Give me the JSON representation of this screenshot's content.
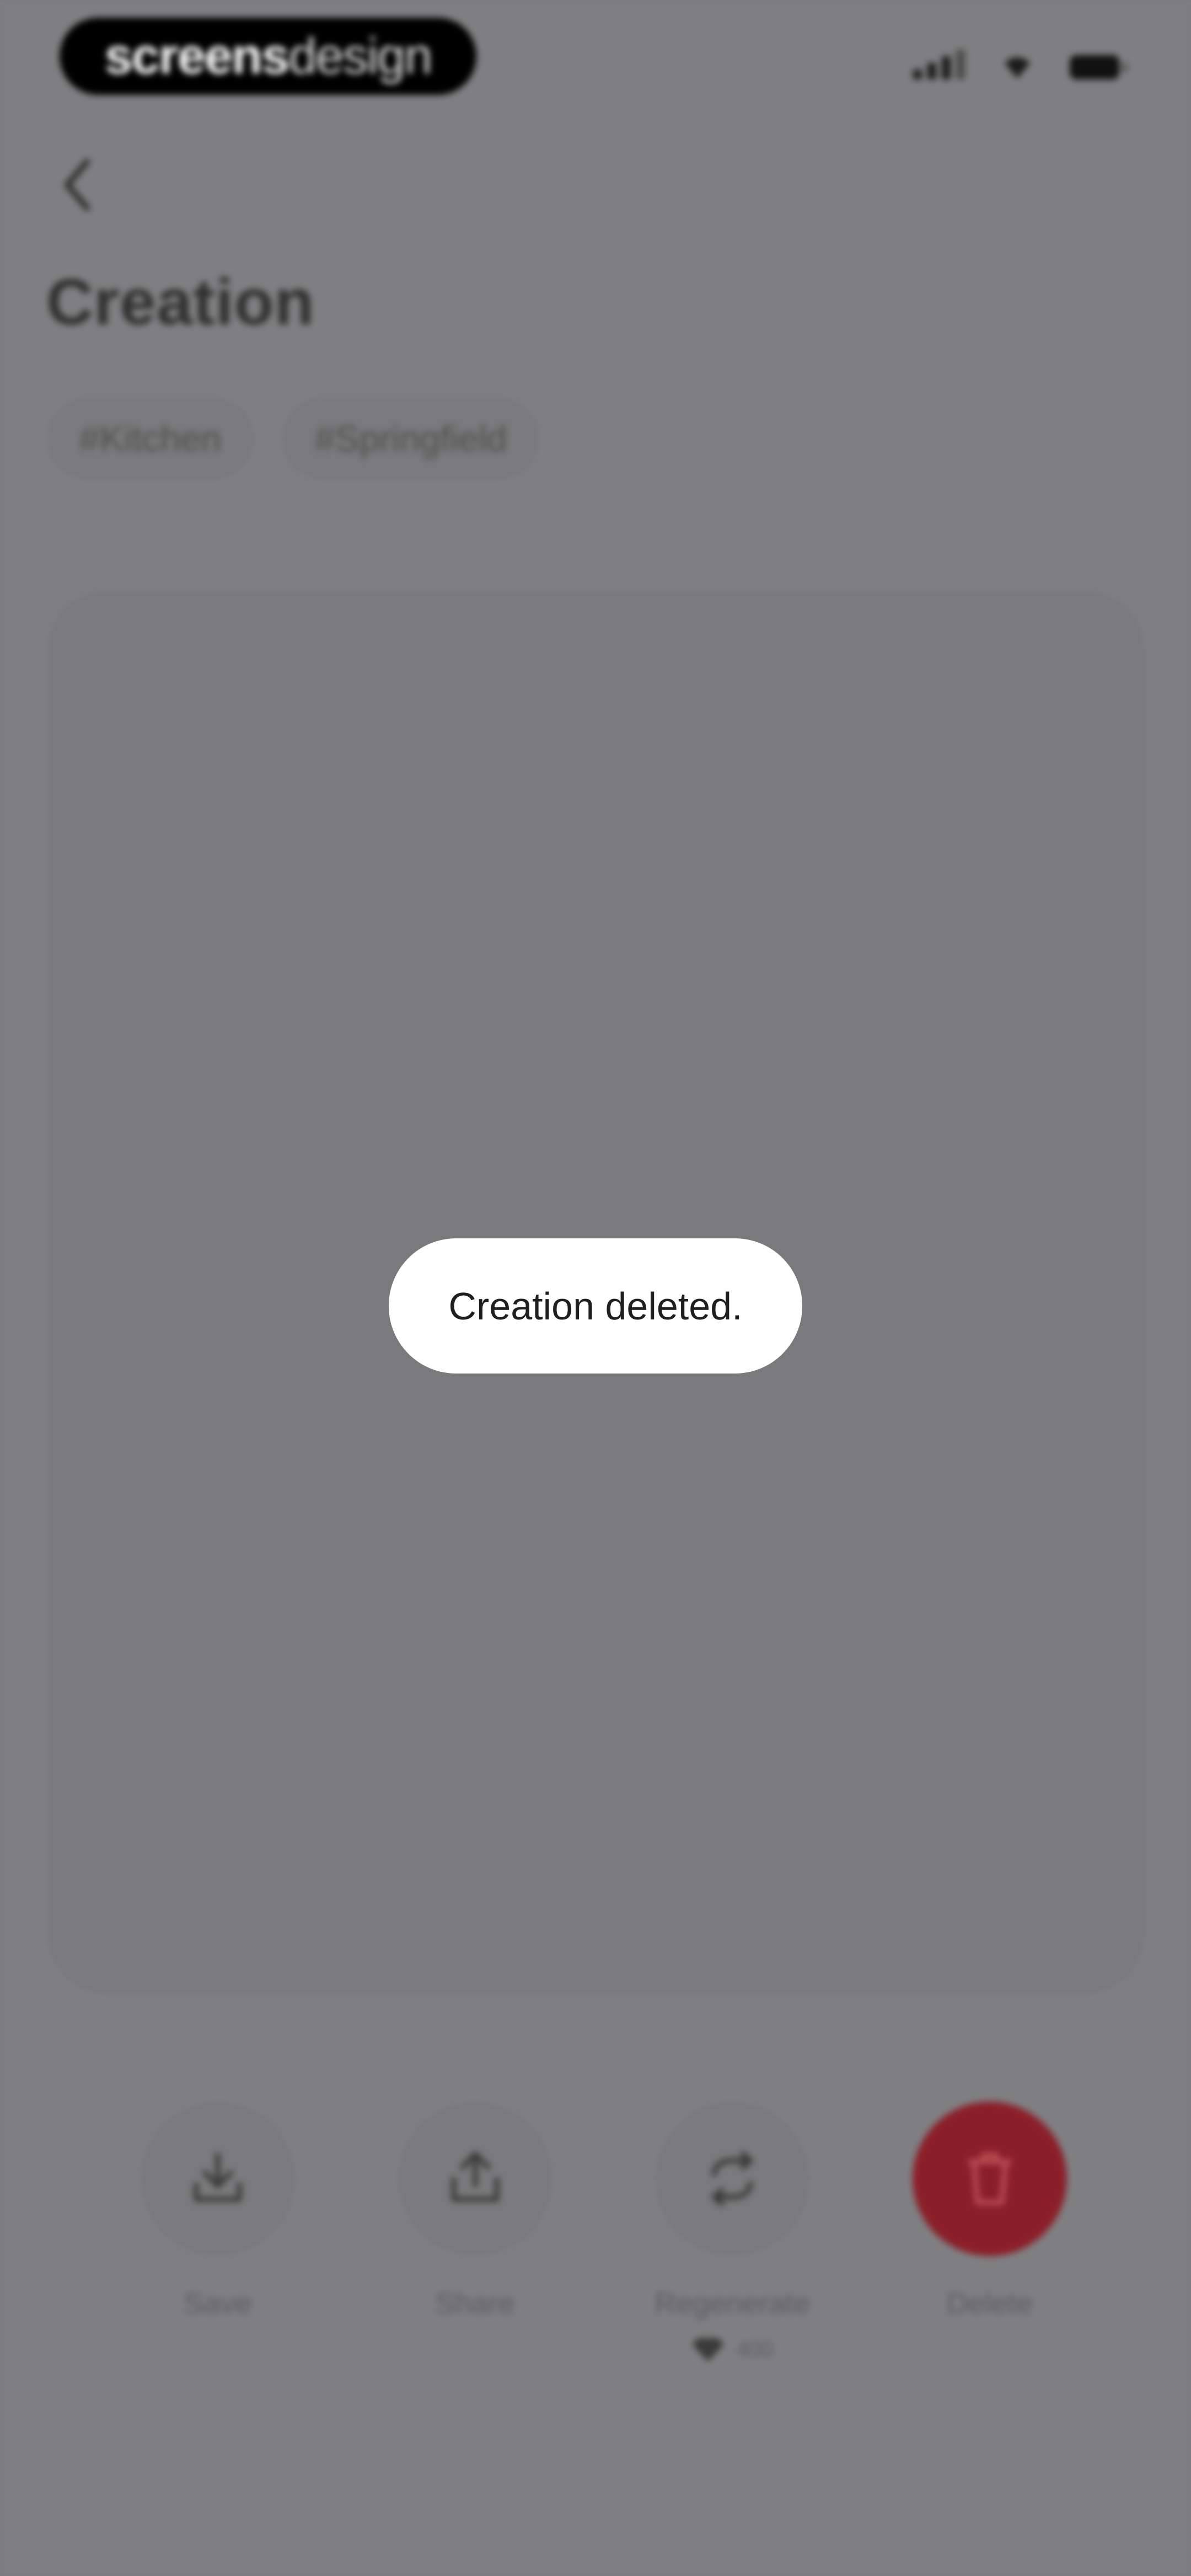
{
  "status_bar": {
    "brand_bold": "screens",
    "brand_light": "design"
  },
  "header": {
    "title": "Creation",
    "back_icon": "chevron-left-icon"
  },
  "tags": [
    "#Kitchen",
    "#Springfield"
  ],
  "actions": [
    {
      "label": "Save",
      "icon": "download-icon"
    },
    {
      "label": "Share",
      "icon": "share-icon"
    },
    {
      "label": "Regenerate",
      "icon": "refresh-icon",
      "cost": "400"
    },
    {
      "label": "Delete",
      "icon": "trash-icon"
    }
  ],
  "toast": {
    "message": "Creation deleted."
  },
  "colors": {
    "overlay": "#7f7f81",
    "delete_accent": "#8b1f29",
    "toast_bg": "#ffffff"
  }
}
